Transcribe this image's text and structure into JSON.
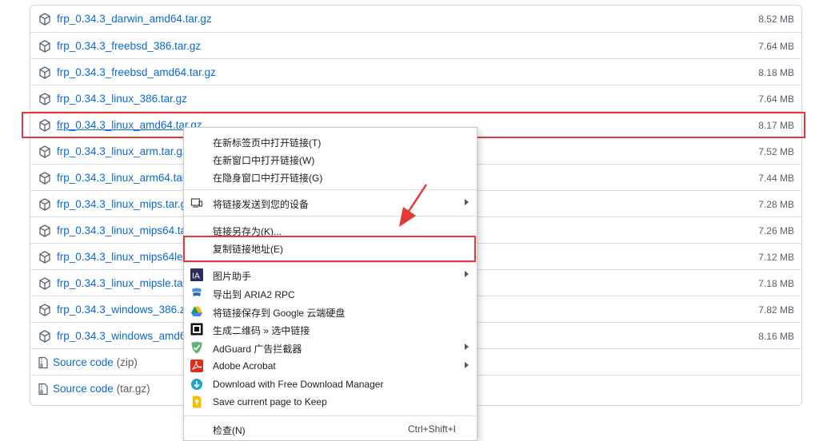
{
  "assets": [
    {
      "name": "frp_0.34.3_darwin_amd64.tar.gz",
      "size": "8.52 MB"
    },
    {
      "name": "frp_0.34.3_freebsd_386.tar.gz",
      "size": "7.64 MB"
    },
    {
      "name": "frp_0.34.3_freebsd_amd64.tar.gz",
      "size": "8.18 MB"
    },
    {
      "name": "frp_0.34.3_linux_386.tar.gz",
      "size": "7.64 MB"
    },
    {
      "name": "frp_0.34.3_linux_amd64.tar.gz",
      "size": "8.17 MB"
    },
    {
      "name": "frp_0.34.3_linux_arm.tar.gz",
      "size": "7.52 MB"
    },
    {
      "name": "frp_0.34.3_linux_arm64.tar.gz",
      "size": "7.44 MB"
    },
    {
      "name": "frp_0.34.3_linux_mips.tar.gz",
      "size": "7.28 MB"
    },
    {
      "name": "frp_0.34.3_linux_mips64.tar.gz",
      "size": "7.26 MB"
    },
    {
      "name": "frp_0.34.3_linux_mips64le.tar.gz",
      "size": "7.12 MB"
    },
    {
      "name": "frp_0.34.3_linux_mipsle.tar.gz",
      "size": "7.18 MB"
    },
    {
      "name": "frp_0.34.3_windows_386.zip",
      "size": "7.82 MB"
    },
    {
      "name": "frp_0.34.3_windows_amd64.zip",
      "size": "8.16 MB"
    }
  ],
  "source": [
    {
      "label": "Source code",
      "fmt": "(zip)"
    },
    {
      "label": "Source code",
      "fmt": "(tar.gz)"
    }
  ],
  "menu": {
    "open_new_tab": "在新标签页中打开链接(T)",
    "open_new_window": "在新窗口中打开链接(W)",
    "open_incognito": "在隐身窗口中打开链接(G)",
    "send_to_devices": "将链接发送到您的设备",
    "save_link_as": "链接另存为(K)...",
    "copy_link": "复制链接地址(E)",
    "image_helper": "图片助手",
    "export_aria2": "导出到 ARIA2 RPC",
    "save_google_drive": "将链接保存到 Google 云端硬盘",
    "qr_code": "生成二维码 » 选中链接",
    "adguard": "AdGuard 广告拦截器",
    "adobe": "Adobe Acrobat",
    "fdm": "Download with Free Download Manager",
    "keep": "Save current page to Keep",
    "inspect": "检查(N)",
    "inspect_shortcut": "Ctrl+Shift+I"
  }
}
